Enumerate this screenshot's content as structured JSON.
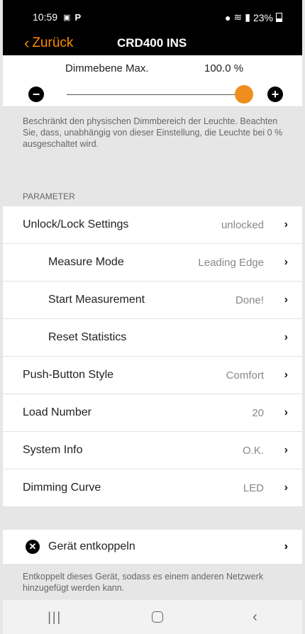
{
  "status": {
    "time": "10:59",
    "battery": "23%",
    "icons": [
      "image-icon",
      "p-icon",
      "location-icon",
      "wifi-icon",
      "signal-icon",
      "battery-icon"
    ]
  },
  "nav": {
    "back_label": "Zurück",
    "title": "CRD400 INS"
  },
  "dimming": {
    "label": "Dimmebene Max.",
    "value": "100.0 %",
    "level": 1.0,
    "accent": "#ef8e1f"
  },
  "info1": "Beschränkt den physischen Dimmbereich der Leuchte. Beachten Sie, dass, unabhängig von dieser Einstellung, die Leuchte bei 0 % ausgeschaltet wird.",
  "section_title": "PARAMETER",
  "rows": [
    {
      "label": "Unlock/Lock Settings",
      "value": "unlocked"
    },
    {
      "label": "Measure Mode",
      "value": "Leading Edge"
    },
    {
      "label": "Start Measurement",
      "value": "Done!"
    },
    {
      "label": "Reset Statistics",
      "value": ""
    },
    {
      "label": "Push-Button Style",
      "value": "Comfort"
    },
    {
      "label": "Load Number",
      "value": "20"
    },
    {
      "label": "System Info",
      "value": "O.K."
    },
    {
      "label": "Dimming Curve",
      "value": "LED"
    }
  ],
  "decouple": {
    "label": "Gerät entkoppeln",
    "info": "Entkoppelt dieses Gerät, sodass es einem anderen Netzwerk hinzugefügt werden kann."
  }
}
